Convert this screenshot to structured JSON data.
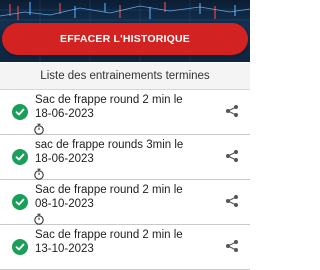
{
  "header": {
    "clear_button_label": "EFFACER L'HISTORIQUE"
  },
  "list": {
    "title": "Liste des entrainements termines",
    "items": [
      {
        "line1": "Sac de frappe round 2 min le",
        "line2": "18-06-2023",
        "icon": "check-circle-icon"
      },
      {
        "line1": "sac de frappe rounds 3min le",
        "line2": "18-06-2023",
        "icon": "check-circle-icon"
      },
      {
        "line1": "Sac de frappe round 2 min le",
        "line2": "08-10-2023",
        "icon": "check-circle-icon"
      },
      {
        "line1": "Sac de frappe round 2 min le",
        "line2": "13-10-2023",
        "icon": "check-circle-icon"
      }
    ]
  },
  "colors": {
    "accent_red": "#d32222",
    "check_green": "#1a9e5a",
    "hero_dark": "#0e2540"
  }
}
